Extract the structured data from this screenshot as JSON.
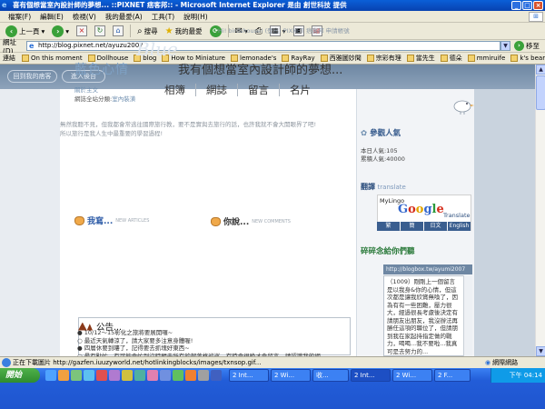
{
  "window": {
    "title": "喜有個想當室內設計師的夢想... ::PIXNET 痞客邦:: - Microsoft Internet Explorer 是由 創世科技 提供",
    "controls": [
      "_",
      "□",
      "×"
    ]
  },
  "menu": [
    "檔案(F)",
    "編輯(E)",
    "檢視(V)",
    "我的最愛(A)",
    "工具(T)",
    "說明(H)"
  ],
  "toolbar": {
    "back": "上一頁",
    "forward_icon": "forward-arrow-icon",
    "search": "搜尋",
    "favorites": "我的最愛"
  },
  "address": {
    "label": "網址(D)",
    "url": "http://blog.pixnet.net/ayuzu2007",
    "go": "移至"
  },
  "links_bar": {
    "label": "連結",
    "items": [
      "On this moment",
      "Dollhouse",
      "blog",
      "How to Miniature",
      "lemonade's",
      "RayRay",
      "西雅圖妙聞",
      "宗彩有理",
      "當先生",
      "德朵",
      "mmiruife",
      "k's bear"
    ]
  },
  "blog": {
    "top_buttons": [
      "回到我的痞客",
      "進入後台"
    ],
    "hi_line": "Hi! birdshouse! (登出)  PIXNET 痞客邦  申請帳號",
    "watermark": "Blue",
    "title": "藍色心情",
    "tagline": "我有個想當室內設計師的夢想...",
    "about_link": "關於主文",
    "site_category_label": "網誌全站分類:",
    "site_category_value": "室內裝潢",
    "nav": [
      "相簿",
      "網誌",
      "留言",
      "名片"
    ],
    "intro_lines": [
      "無然我聽不見，但我都會常逃往國際旅行教，要不是實與去旅行的話，也許我就不會大開眼界了吧!",
      "所以旅行是我人生中最重要的學習過程!"
    ],
    "section_articles": {
      "title": "我寫...",
      "sub": "NEW ARTICLES"
    },
    "section_comments": {
      "title": "你說...",
      "sub": "NEW COMMENTS"
    },
    "announcement": {
      "title": "公告...",
      "lines": [
        "● 10/12～15彰化之旅將要展開囉~",
        "○ 最近天氣轉涼了，請大家要多注意身體喔!",
        "● 四層休要到嘍了，記得要去抓塊好東西~",
        "○ 最有點忙，有可能會忙到沒時間去所有的部落格巡巡，有時會很晚才會留言，請認識我的網",
        "友、朋友多包容，真是感謝不盡啊!"
      ]
    },
    "sidebar": {
      "visitors_title": "參觀人氣",
      "today_label": "本日人氣:",
      "today_value": "105",
      "total_label": "累積人氣:",
      "total_value": "40000",
      "translate_title": "翻譯",
      "translate_sub": "translate",
      "mylingo": "MyLingo",
      "google": [
        "G",
        "o",
        "o",
        "g",
        "l",
        "e"
      ],
      "translate_word": "Translate",
      "languages": [
        "繁",
        "簡",
        "日文",
        "English"
      ],
      "notes_title": "碎碎念給你們聽",
      "notes_url": "http://blogbox.tw/ayumi2007",
      "notes_text": "（1009）剛剛上一個留言是以我身&你的心情，但這次都是讓我欣賞無喚了，因為有有一些困難，壓力很大，經過很長考慮後決定有請朋友出朋友，我沒辦法再勝任這項的職位了，但請朋到我在家起持指定做的戰力，喝喝...我不要啦...我真可是去努力的..."
    }
  },
  "status": {
    "text": "正在下載圖片 http://gazfen.iuuzyworld.net/hotlinkingblocks/images/txnsop.gif...",
    "zone": "網際網路"
  },
  "taskbar": {
    "start": "開始",
    "tasks": [
      "2 Int...",
      "2 Wi...",
      "收...",
      "2 Int...",
      "2 Wi...",
      "2 F..."
    ],
    "clock": "下午 04:14"
  }
}
